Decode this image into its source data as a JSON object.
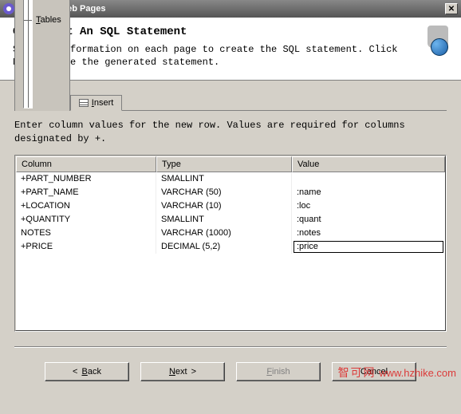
{
  "window": {
    "title": "Database Web Pages"
  },
  "header": {
    "heading": "Construct An SQL Statement",
    "subtext": "Specify information on each page to create the SQL statement. Click Next to see the generated statement."
  },
  "tabs": {
    "tables_label": "Tables",
    "insert_label": "Insert"
  },
  "instruction": "Enter column values for the new row.  Values are required for columns designated by +.",
  "grid": {
    "headers": {
      "col1": "Column",
      "col2": "Type",
      "col3": "Value"
    },
    "rows": [
      {
        "column": "+PART_NUMBER",
        "type": "SMALLINT",
        "value": ""
      },
      {
        "column": "+PART_NAME",
        "type": "VARCHAR (50)",
        "value": ":name"
      },
      {
        "column": "+LOCATION",
        "type": "VARCHAR (10)",
        "value": ":loc"
      },
      {
        "column": "+QUANTITY",
        "type": "SMALLINT",
        "value": ":quant"
      },
      {
        "column": " NOTES",
        "type": "VARCHAR (1000)",
        "value": ":notes"
      },
      {
        "column": "+PRICE",
        "type": "DECIMAL (5,2)",
        "value": ":price",
        "editing": true
      }
    ]
  },
  "buttons": {
    "back": {
      "label": "Back",
      "arrow": "<",
      "enabled": true
    },
    "next": {
      "label": "Next",
      "arrow": ">",
      "enabled": true
    },
    "finish": {
      "label": "Finish",
      "enabled": false
    },
    "cancel": {
      "label": "Cancel",
      "enabled": true
    }
  },
  "watermark": {
    "han": "智可网",
    "url": "www.hzhike.com"
  }
}
